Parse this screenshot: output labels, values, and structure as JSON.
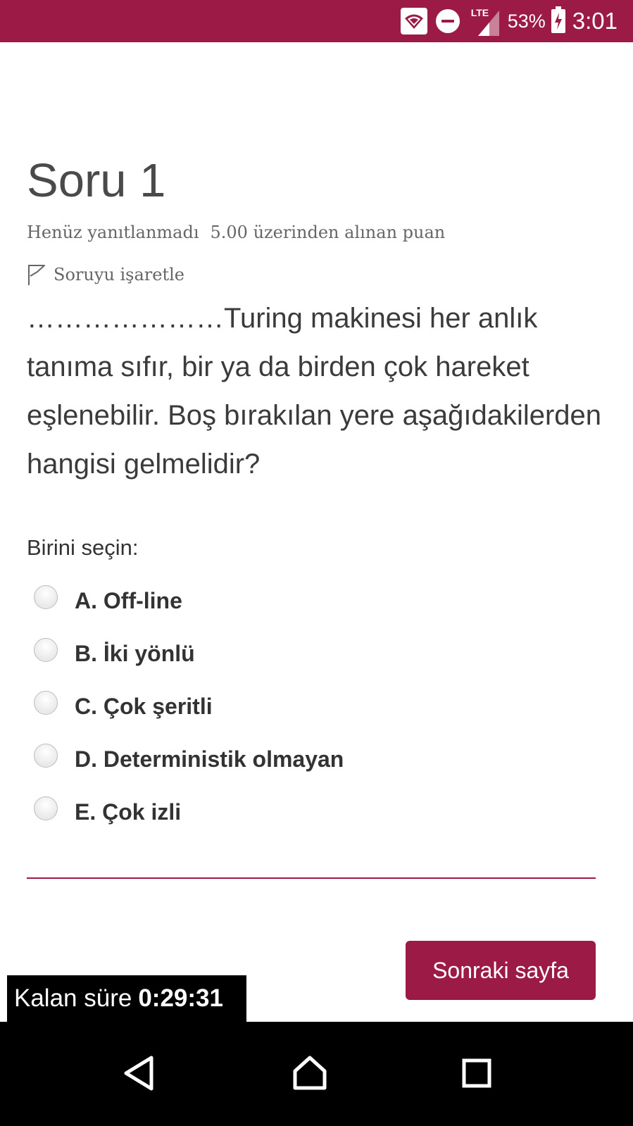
{
  "status_bar": {
    "network": "LTE",
    "battery_pct": "53%",
    "time": "3:01",
    "icons": [
      "wifi-icon",
      "do-not-disturb-icon",
      "signal-icon",
      "battery-charging-icon"
    ]
  },
  "question": {
    "title": "Soru 1",
    "status": "Henüz yanıtlanmadı",
    "points": "5.00 üzerinden alınan puan",
    "flag_label": "Soruyu işaretle",
    "text": "…………………Turing makinesi her anlık tanıma sıfır, bir ya da birden çok hareket eşlenebilir. Boş bırakılan yere aşağıdakilerden hangisi gelmelidir?",
    "choose_label": "Birini seçin:",
    "options": [
      {
        "label": "A. Off-line"
      },
      {
        "label": "B. İki yönlü"
      },
      {
        "label": "C. Çok şeritli"
      },
      {
        "label": "D. Deterministik olmayan"
      },
      {
        "label": "E. Çok izli"
      }
    ]
  },
  "actions": {
    "next_label": "Sonraki sayfa"
  },
  "timer": {
    "label": "Kalan süre",
    "value": "0:29:31"
  },
  "colors": {
    "accent": "#9b1b46",
    "text": "#3b3b3b"
  }
}
